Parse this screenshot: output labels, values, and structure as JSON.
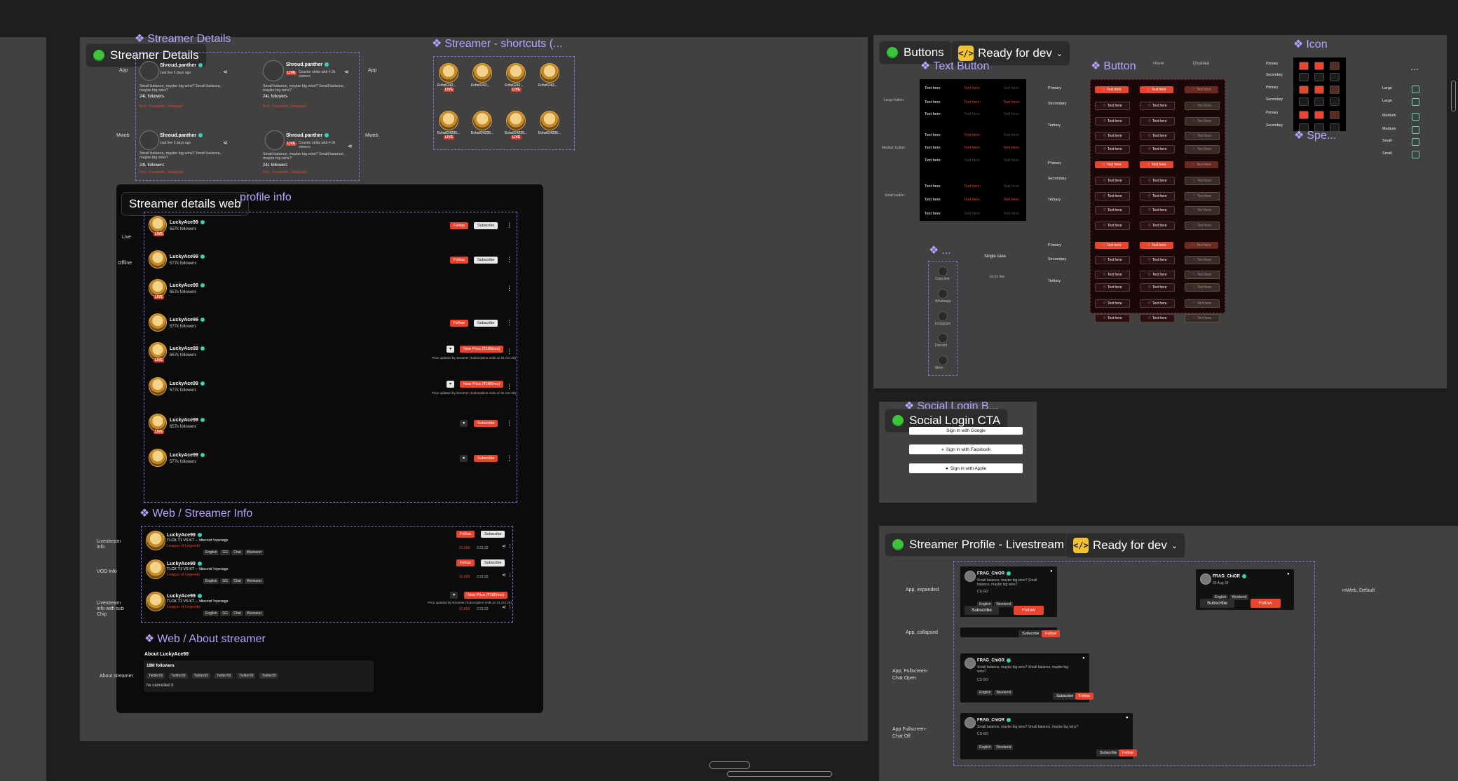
{
  "frames": {
    "streamer_details": "Streamer Details",
    "streamer_details_web": "Streamer details web",
    "buttons": "Buttons",
    "social_login_cta": "Social Login CTA",
    "streamer_profile_livestream": "Streamer Profile - Livestream",
    "ready_for_dev": "Ready for dev"
  },
  "components": {
    "streamer_details": "Streamer Details",
    "streamer_shortcuts": "Streamer - shortcuts (...",
    "profile_info": "profile info",
    "web_streamer_info": "Web / Streamer Info",
    "web_about_streamer": "Web / About streamer",
    "text_button": "Text Button",
    "button": "Button",
    "icon": "Icon",
    "spe": "Spe...",
    "share": "...",
    "social_login_b": "Social Login B..."
  },
  "streamer_details": {
    "variant_app": "App",
    "variant_mweb": "Mweb",
    "cards": [
      {
        "name": "Shroud.panther",
        "sub": "Last live 6 days ago",
        "desc": "Small balance, maybe big wins? Small balance, maybe big wins?",
        "followers": "24L followers"
      },
      {
        "name": "Shroud.panther",
        "sub": "Counter strike with 4.3k viewers",
        "live": "LIVE",
        "desc": "Small balance, maybe big wins? Small balance, maybe big wins?",
        "followers": "24L followers"
      },
      {
        "name": "Shroud.panther",
        "sub": "Last live 6 days ago",
        "desc": "Small balance, maybe big wins? Small balance, maybe big wins?",
        "followers": "24L followers"
      },
      {
        "name": "Shroud.panther",
        "sub": "Counter strike with 4.3k viewers",
        "live": "LIVE",
        "desc": "Small balance, maybe big wins? Small balance, maybe big wins?",
        "followers": "24L followers"
      }
    ],
    "socials": [
      "Kick",
      "Facebook",
      "Instagram"
    ]
  },
  "shortcuts": {
    "items": [
      {
        "name": "Echo0242...",
        "live": "LIVE"
      },
      {
        "name": "Echo0242...",
        "live": ""
      },
      {
        "name": "Echo0242...",
        "live": "LIVE"
      },
      {
        "name": "Echo0242...",
        "live": ""
      },
      {
        "name": "Echo024235...",
        "live": "LIVE"
      },
      {
        "name": "Echo024235...",
        "live": ""
      },
      {
        "name": "Echo024235...",
        "live": "LIVE"
      },
      {
        "name": "Echo024235...",
        "live": ""
      }
    ],
    "variant_app": "App",
    "variant_mweb": "Mweb"
  },
  "profile_info": {
    "state_live": "Live",
    "state_offline": "Offline",
    "rows": [
      {
        "name": "LuckyAce99",
        "followers": "657k followers",
        "live": "LIVE",
        "actions": "follow_sub"
      },
      {
        "name": "LuckyAce99",
        "followers": "577k followers",
        "live": "",
        "actions": "follow_sub"
      },
      {
        "name": "LuckyAce99",
        "followers": "657k followers",
        "live": "LIVE",
        "actions": "kebab"
      },
      {
        "name": "LuckyAce99",
        "followers": "577k followers",
        "live": "",
        "actions": "follow_sub"
      },
      {
        "name": "LuckyAce99",
        "followers": "657k followers",
        "live": "LIVE",
        "actions": "new_price"
      },
      {
        "name": "LuckyAce99",
        "followers": "577k followers",
        "live": "",
        "actions": "new_price"
      },
      {
        "name": "LuckyAce99",
        "followers": "657k followers",
        "live": "LIVE",
        "actions": "heart_sub"
      },
      {
        "name": "LuckyAce99",
        "followers": "577k followers",
        "live": "",
        "actions": "heart_sub"
      }
    ],
    "follow_label": "Follow",
    "subscribe_label": "Subscribe",
    "new_price_label": "New Price (₹180/mo)",
    "price_note": "Price updated by streamer (Subscription ends on 01 Oct 25)"
  },
  "web_streamer_info": {
    "labels": [
      "Livestream info",
      "VOD Info",
      "Livestream info with sub Chip"
    ],
    "rows": [
      {
        "name": "LuckyAce99",
        "title": "TLCK T1 VS KT – !discord !operagx",
        "game": "League of Legends",
        "chips": [
          "English",
          "GG",
          "Chat",
          "Weekend"
        ],
        "viewers": "91,699",
        "time": "2:21:22"
      },
      {
        "name": "LuckyAce99",
        "title": "TLCK T1 VS KT – !discord !operagx",
        "game": "League of Legends",
        "chips": [
          "English",
          "GG",
          "Chat",
          "Weekend"
        ],
        "viewers": "91,699",
        "time": "2:21:22"
      },
      {
        "name": "LuckyAce99",
        "title": "TLCK T1 VS KT – !discord !operagx",
        "game": "League of Legends",
        "chips": [
          "English",
          "GG",
          "Chat",
          "Weekend"
        ],
        "viewers": "91,699",
        "time": "2:21:22"
      }
    ]
  },
  "about_streamer": {
    "label": "About streamer",
    "heading": "About LuckyAce99",
    "followers": "18M followers",
    "socials": [
      "Twitter99",
      "Twitter99",
      "Twitter99",
      "Twitter99",
      "Twitter99",
      "Twitter99"
    ],
    "bio": "he cancelled it"
  },
  "buttons_panel": {
    "col_hover": "Hover",
    "col_disabled": "Disabled",
    "text_here": "Text here",
    "size_labels": [
      "Large button",
      "Medium button",
      "Small button"
    ],
    "row_labels": [
      "Primary",
      "Secondary",
      "Tertiary",
      "Primary",
      "Secondary",
      "Tertiary",
      "Primary",
      "Secondary",
      "Tertiary"
    ],
    "icon_sizes": [
      "Large",
      "Large",
      "Medium",
      "Medium",
      "Small",
      "Small"
    ],
    "icon_rows": [
      "Primary",
      "Secondary",
      "Primary",
      "Secondary",
      "Primary",
      "Secondary"
    ],
    "share_items": [
      "Copy link",
      "Whatsapp",
      "Instagram",
      "Discord",
      "More"
    ],
    "single_case": "Single case",
    "go_to_live": "Go to live"
  },
  "social_login": {
    "google": "Sign in with Google",
    "facebook": "Sign in with Facebook",
    "apple": "Sign in with Apple"
  },
  "streamer_profile": {
    "labels": [
      "App, expanded",
      "App, collapsed",
      "App, Fullscreen-Chat Open",
      "App Fullscreen-Chat Off"
    ],
    "mweb_label": "mWeb, Default",
    "name": "FRAG_ChiOR",
    "desc": "Small balance, maybe big wins? Small balance, maybe big wins?",
    "game": "CS GO",
    "date": "26 Aug 25",
    "chips": [
      "English",
      "Weekend"
    ],
    "subscribe": "Subscribe",
    "follow": "Follow"
  },
  "colors": {
    "accent": "#e8452f",
    "brand_purple": "#b9a2ff",
    "ready": "#f2c230",
    "green": "#3cc53c"
  }
}
